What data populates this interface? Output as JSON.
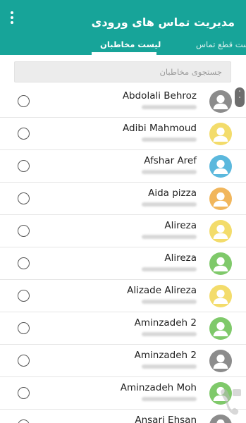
{
  "header": {
    "title": "مدیریت تماس های ورودی",
    "menu_icon": "more-vert-icon",
    "bg_color": "#17a499"
  },
  "tabs": [
    {
      "label": "لیست قطع تماس",
      "active": false
    },
    {
      "label": "لیست مخاطبان",
      "active": true
    }
  ],
  "search": {
    "placeholder": "جستجوی مخاطبان",
    "value": ""
  },
  "contacts": [
    {
      "name": "Abdolali Behroz",
      "avatar_color": "#8c8c8c",
      "selected": false
    },
    {
      "name": "Adibi Mahmoud",
      "avatar_color": "#f3dc6b",
      "selected": false
    },
    {
      "name": "Afshar Aref",
      "avatar_color": "#5bb8dd",
      "selected": false
    },
    {
      "name": "Aida pizza",
      "avatar_color": "#f1b65c",
      "selected": false
    },
    {
      "name": "Alireza",
      "avatar_color": "#f3dc6b",
      "selected": false
    },
    {
      "name": "Alireza",
      "avatar_color": "#7fc96a",
      "selected": false
    },
    {
      "name": "Alizade Alireza",
      "avatar_color": "#f3dc6b",
      "selected": false
    },
    {
      "name": "Aminzadeh 2",
      "avatar_color": "#7fc96a",
      "selected": false
    },
    {
      "name": "Aminzadeh 2",
      "avatar_color": "#8c8c8c",
      "selected": false
    },
    {
      "name": "Aminzadeh Moh",
      "avatar_color": "#7fc96a",
      "selected": false
    },
    {
      "name": "Ansari Ehsan",
      "avatar_color": "#8c8c8c",
      "selected": false
    }
  ],
  "icons": {
    "avatar": "person-icon",
    "radio": "radio-unchecked-icon",
    "scroll": "fast-scroll-thumb-icon",
    "watermark": "app-logo-watermark-icon"
  }
}
